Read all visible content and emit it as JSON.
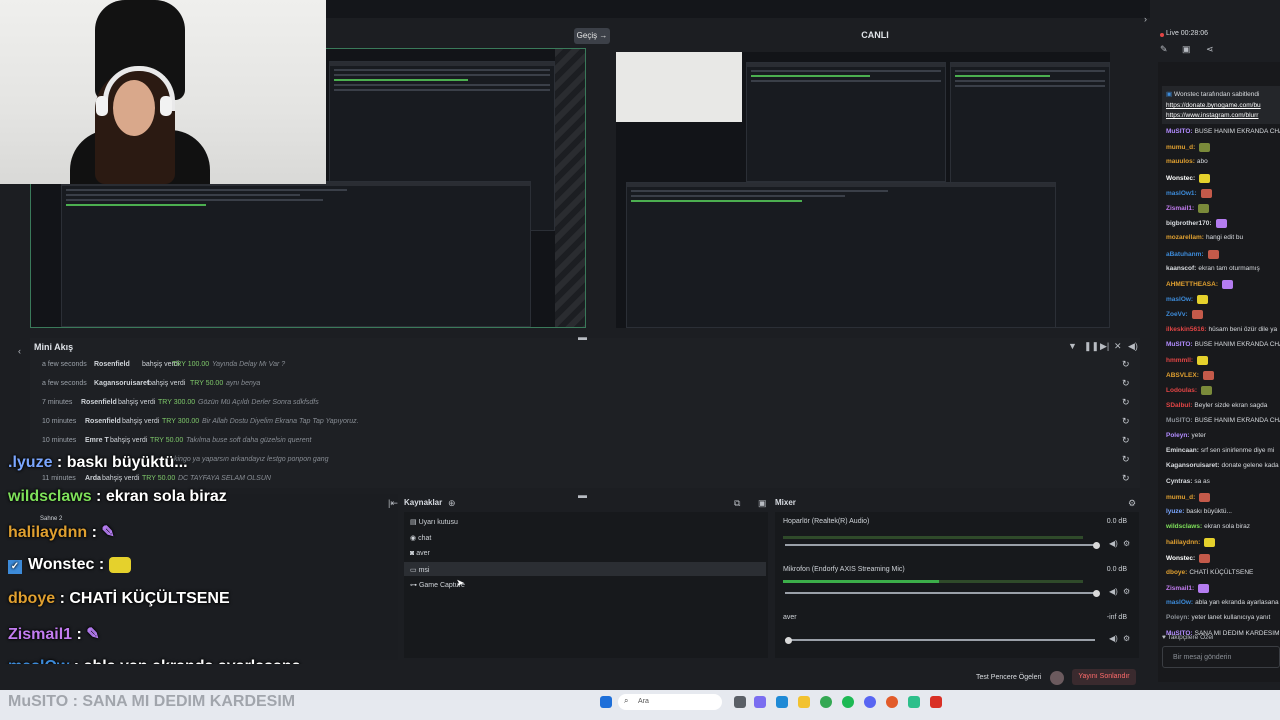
{
  "top": {
    "transition_label": "Geçiş →",
    "live_title": "CANLI"
  },
  "mini_akis": {
    "title": "Mini Akış",
    "rows": [
      {
        "time": "a few seconds",
        "user": "Rosenfield",
        "verb": "bahşiş verdi",
        "amount": "TRY 100.00",
        "msg": "Yayında Delay Mı Var ?"
      },
      {
        "time": "a few seconds",
        "user": "Kagansoruisaret",
        "verb": "bahşiş verdi",
        "amount": "TRY 50.00",
        "msg": "aynı benya"
      },
      {
        "time": "7 minutes",
        "user": "Rosenfield",
        "verb": "bahşiş verdi",
        "amount": "TRY 300.00",
        "msg": "Gözün Mü Açıldı Derler Sonra sdkfsdfs"
      },
      {
        "time": "10 minutes",
        "user": "Rosenfield",
        "verb": "bahşiş verdi",
        "amount": "TRY 300.00",
        "msg": "Bir Allah Dostu Diyelim Ekrana Tap Tap Yapıyoruz."
      },
      {
        "time": "10 minutes",
        "user": "Emre T",
        "verb": "bahşiş verdi",
        "amount": "TRY 50.00",
        "msg": "Takılma buse soft daha güzelsin querent"
      },
      {
        "time": "",
        "user": "",
        "verb": "",
        "amount": "",
        "msg": "kingo ya yaparsın arkandayız lestgo ponpon gang"
      },
      {
        "time": "11 minutes",
        "user": "Arda",
        "verb": "bahşiş verdi",
        "amount": "TRY 50.00",
        "msg": "DC TAYFAYA SELAM OLSUN"
      }
    ]
  },
  "overlay_chat": [
    {
      "user": ".lyuze",
      "sep": " : ",
      "msg": "baskı büyüktü...",
      "color": "#7aa6ff"
    },
    {
      "user": "wildsclaws",
      "sep": " : ",
      "msg": "ekran sola biraz",
      "color": "#7ee05a"
    },
    {
      "user": "halilaydnn",
      "sep": " : ",
      "msg": "",
      "color": "#e0a030"
    },
    {
      "user": "Wonstec",
      "sep": " : ",
      "msg": "",
      "color": "#ffffff"
    },
    {
      "user": "dboye",
      "sep": " : ",
      "msg": "CHATİ KÜÇÜLTSENE",
      "color": "#e0a030"
    },
    {
      "user": "Zismail1",
      "sep": " : ",
      "msg": "",
      "color": "#c27cf0"
    },
    {
      "user": "maslQw",
      "sep": " : ",
      "msg": "abla yan ekranda ayarlasana",
      "color": "#3d8bd9"
    }
  ],
  "musito_line": "MuSITO : SANA MI DEDIM KARDESIM",
  "scenes": {
    "scene_name": "Sahne 2"
  },
  "sources": {
    "title": "Kaynaklar",
    "items": [
      "Uyarı kutusu",
      "chat",
      "aver",
      "msi",
      "Game Capture"
    ]
  },
  "mixer": {
    "title": "Mixer",
    "channels": [
      {
        "name": "Hoparlör (Realtek(R) Audio)",
        "db": "0.0 dB",
        "level": 0.0
      },
      {
        "name": "Mikrofon (Endorfy AXIS Streaming Mic)",
        "db": "0.0 dB",
        "level": 0.52
      },
      {
        "name": "aver",
        "db": "-inf dB",
        "level": 0.0
      }
    ]
  },
  "bottom": {
    "test_label": "Test Pencere Ögeleri",
    "end_label": "Yayını Sonlandır"
  },
  "right_panel": {
    "live_label": "Live 00:28:06",
    "pinned_by": "Wonstec tarafından sabitlendi",
    "pinned_links": [
      "https://donate.bynogame.com/bu",
      "https://www.instagram.com/blurr"
    ],
    "messages": [
      {
        "user": "MuSITO:",
        "text": "BUSE HANIM EKRANDA CHA",
        "color": "#b28cff"
      },
      {
        "user": "mumu_d:",
        "text": "",
        "color": "#e0a030"
      },
      {
        "user": "mauulos:",
        "text": "abo",
        "color": "#e0a030"
      },
      {
        "user": "Wonstec:",
        "text": "",
        "color": "#ffffff"
      },
      {
        "user": "maslOw1:",
        "text": "",
        "color": "#3d8bd9"
      },
      {
        "user": "Zismail1:",
        "text": "",
        "color": "#c27cf0"
      },
      {
        "user": "bigbrother170:",
        "text": "",
        "color": "#d9dce0"
      },
      {
        "user": "mozarellam:",
        "text": "hangi edit bu",
        "color": "#e0a030"
      },
      {
        "user": "aBatuhanm:",
        "text": "",
        "color": "#3d8bd9"
      },
      {
        "user": "kaanscof:",
        "text": "ekran tam oturmamış",
        "color": "#d9dce0"
      },
      {
        "user": "AHMETTHEASA:",
        "text": "",
        "color": "#e0a030"
      },
      {
        "user": "maslOw:",
        "text": "",
        "color": "#3d8bd9"
      },
      {
        "user": "ZoeVv:",
        "text": "",
        "color": "#3d8bd9"
      },
      {
        "user": "ilkeskin5616:",
        "text": "hüsam beni özür dile ya",
        "color": "#e34545"
      },
      {
        "user": "MuSITO:",
        "text": "BUSE HANIM EKRANDA CHA",
        "color": "#b28cff"
      },
      {
        "user": "hmmmll:",
        "text": "",
        "color": "#e34545"
      },
      {
        "user": "ABSVLEX:",
        "text": "",
        "color": "#e0a030"
      },
      {
        "user": "Lodoulas:",
        "text": "",
        "color": "#e34545"
      },
      {
        "user": "SDalbul:",
        "text": "Beyler sizde ekran sagda",
        "color": "#e34545"
      },
      {
        "user": "MuSITO:",
        "text": "BUSE HANIM EKRANDA CHA",
        "color": "#8a8f96"
      },
      {
        "user": "Poleyn:",
        "text": "yeter",
        "color": "#b28cff"
      },
      {
        "user": "Emincaan:",
        "text": "srf sen sinirlenme diye mi",
        "color": "#d9dce0"
      },
      {
        "user": "Kagansoruisaret:",
        "text": "donate gelene kada",
        "color": "#d9dce0"
      },
      {
        "user": "Cyntras:",
        "text": "sa as",
        "color": "#d9dce0"
      },
      {
        "user": "mumu_d:",
        "text": "",
        "color": "#e0a030"
      },
      {
        "user": "lyuze:",
        "text": "baskı büyüktü...",
        "color": "#7aa6ff"
      },
      {
        "user": "wildsclaws:",
        "text": "ekran sola biraz",
        "color": "#7ee05a"
      },
      {
        "user": "halilaydnn:",
        "text": "",
        "color": "#e0a030"
      },
      {
        "user": "Wonstec:",
        "text": "",
        "color": "#ffffff"
      },
      {
        "user": "dboye:",
        "text": "CHATİ KÜÇÜLTSENE",
        "color": "#e0a030"
      },
      {
        "user": "Zismail1:",
        "text": "",
        "color": "#c27cf0"
      },
      {
        "user": "maslOw:",
        "text": "abla yan ekranda ayarlasana",
        "color": "#3d8bd9"
      },
      {
        "user": "Poleyn:",
        "text": "yeter lanet kullanıcıya yanıt",
        "color": "#8a8f96"
      },
      {
        "user": "MuSITO:",
        "text": "SANA MI DEDIM KARDESIM",
        "color": "#b28cff"
      }
    ],
    "followers_label": "Takipçilere Özel",
    "input_placeholder": "Bir mesaj gönderin"
  },
  "taskbar": {
    "search_placeholder": "Ara"
  }
}
